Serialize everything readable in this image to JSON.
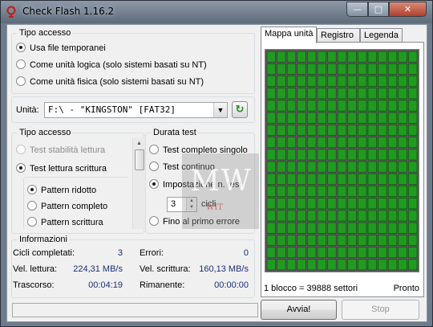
{
  "window": {
    "title": "Check Flash 1.16.2",
    "controls": {
      "minimize": "—",
      "maximize": "□",
      "close": "✕"
    }
  },
  "access_type_1": {
    "title": "Tipo accesso",
    "options": [
      {
        "label": "Usa file temporanei",
        "checked": true
      },
      {
        "label": "Come unità logica (solo sistemi basati su NT)",
        "checked": false
      },
      {
        "label": "Come unità fisica (solo sistemi basati su NT)",
        "checked": false
      }
    ]
  },
  "drive": {
    "label": "Unità:",
    "selected": "F:\\ - \"KINGSTON\" [FAT32]",
    "refresh_icon": "refresh-icon"
  },
  "access_type_2": {
    "title": "Tipo accesso",
    "options": [
      {
        "label": "Test stabilità lettura",
        "checked": false,
        "disabled": true
      },
      {
        "label": "Test lettura scrittura",
        "checked": true,
        "disabled": false
      }
    ],
    "patterns": [
      {
        "label": "Pattern ridotto",
        "checked": true
      },
      {
        "label": "Pattern completo",
        "checked": false
      },
      {
        "label": "Pattern scrittura",
        "checked": false
      }
    ]
  },
  "duration": {
    "title": "Durata test",
    "options": [
      {
        "label": "Test completo singolo",
        "checked": false
      },
      {
        "label": "Test continuo",
        "checked": false
      },
      {
        "label": "Impostazione n. test",
        "checked": true
      },
      {
        "label": "Fino al primo errore",
        "checked": false
      }
    ],
    "count_value": "3",
    "count_unit": "cicli"
  },
  "info": {
    "title": "Informazioni",
    "cycles_label": "Cicli completati:",
    "cycles_value": "3",
    "errors_label": "Errori:",
    "errors_value": "0",
    "read_label": "Vel. lettura:",
    "read_value": "224,31 MB/s",
    "write_label": "Vel. scrittura:",
    "write_value": "160,13 MB/s",
    "elapsed_label": "Trascorso:",
    "elapsed_value": "00:04:19",
    "remaining_label": "Rimanente:",
    "remaining_value": "00:00:00"
  },
  "tabs": [
    {
      "label": "Mappa unità",
      "active": true
    },
    {
      "label": "Registro",
      "active": false
    },
    {
      "label": "Legenda",
      "active": false
    }
  ],
  "map": {
    "block_info": "1 blocco = 39888 settori",
    "status": "Pronto",
    "columns": 15,
    "rows": 18,
    "block_color": "#1f9b1f",
    "block_border": "#0b4a0b"
  },
  "buttons": {
    "start": "Avvia!",
    "stop": "Stop"
  },
  "watermark": {
    "text": "MW",
    "sub": "WIT"
  }
}
